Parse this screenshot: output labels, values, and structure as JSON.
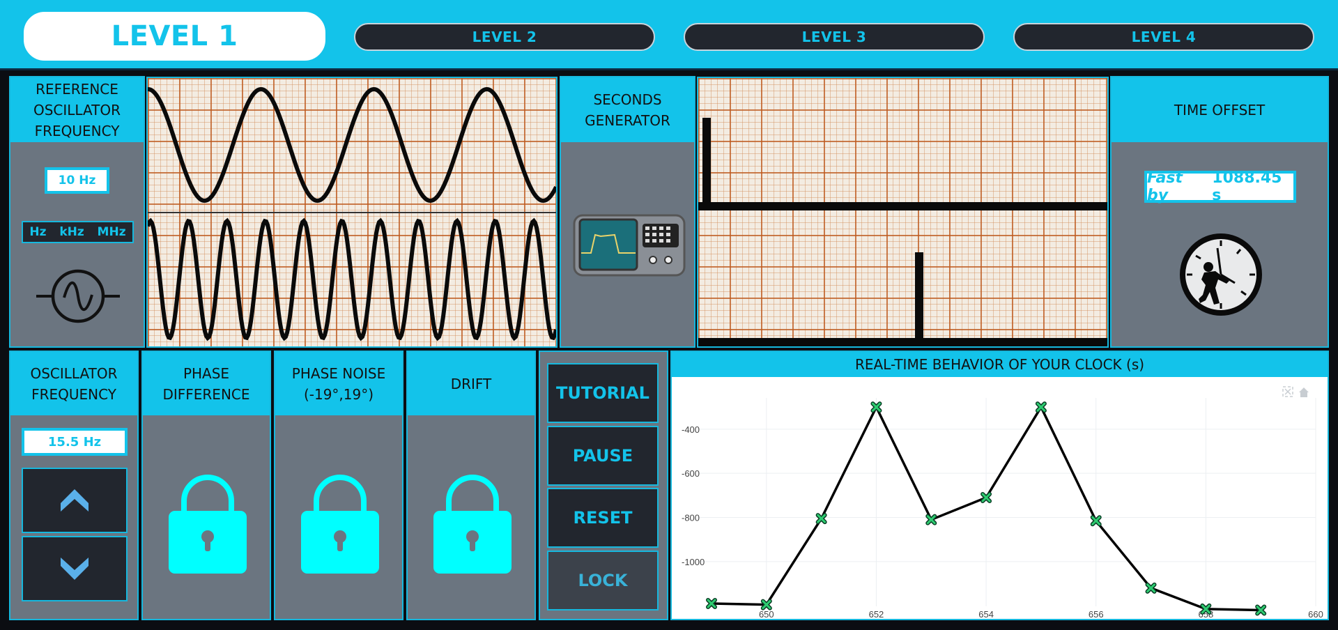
{
  "levels": [
    "LEVEL 1",
    "LEVEL 2",
    "LEVEL 3",
    "LEVEL 4"
  ],
  "reference": {
    "title": "REFERENCE OSCILLATOR FREQUENCY",
    "title_lines": [
      "REFERENCE",
      "OSCILLATOR",
      "FREQUENCY"
    ],
    "value": "10 Hz",
    "units": [
      "Hz",
      "kHz",
      "MHz"
    ],
    "icon": "sine-source-icon"
  },
  "seconds_generator": {
    "title_lines": [
      "SECONDS",
      "GENERATOR"
    ],
    "icon": "oscilloscope-device-icon"
  },
  "time_offset": {
    "title": "TIME OFFSET",
    "prefix": "Fast by",
    "value": "1088.45 s",
    "icon": "clock-with-figure-icon"
  },
  "oscillator": {
    "title_lines": [
      "OSCILLATOR",
      "FREQUENCY"
    ],
    "value": "15.5 Hz",
    "up_icon": "chevron-up-icon",
    "down_icon": "chevron-down-icon"
  },
  "locks": [
    {
      "title_lines": [
        "PHASE",
        "DIFFERENCE"
      ],
      "icon": "lock-icon"
    },
    {
      "title_lines": [
        "PHASE NOISE",
        "(-19°,19°)"
      ],
      "icon": "lock-icon"
    },
    {
      "title_lines": [
        "DRIFT"
      ],
      "icon": "lock-icon"
    }
  ],
  "controls": [
    "TUTORIAL",
    "PAUSE",
    "RESET",
    "LOCK"
  ],
  "colors": {
    "accent": "#13c3ea",
    "panel": "#6b7580",
    "dark": "#22262e",
    "lock": "#00ffff"
  },
  "chart_data": {
    "type": "line",
    "title": "REAL-TIME BEHAVIOR OF YOUR CLOCK (s)",
    "x": [
      649,
      650,
      651,
      652,
      653,
      654,
      655,
      656,
      657,
      658,
      659
    ],
    "y": [
      -1190,
      -1195,
      -805,
      -300,
      -810,
      -710,
      -300,
      -815,
      -1120,
      -1215,
      -1220
    ],
    "xlim": [
      649,
      660
    ],
    "ylim": [
      -1190,
      -290
    ],
    "xticks": [
      650,
      652,
      654,
      656,
      658,
      660
    ],
    "yticks": [
      -400,
      -600,
      -800,
      -1000
    ],
    "ytick_labels": [
      "-400",
      "-600",
      "-800",
      "-1000"
    ],
    "marker": "x",
    "line_color": "#000000",
    "marker_color": "#2ecc71",
    "grid": true
  }
}
